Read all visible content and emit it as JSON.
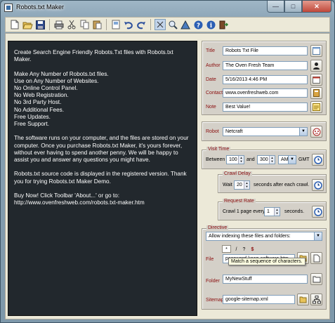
{
  "window": {
    "title": "Robots.txt Maker"
  },
  "toolbar": {
    "icons": [
      "new-file-icon",
      "open-folder-icon",
      "save-icon",
      "print-icon",
      "cut-icon",
      "copy-icon",
      "paste-icon",
      "preview-icon",
      "undo-icon",
      "redo-icon",
      "tile-icon",
      "search-icon",
      "shape-icon",
      "help-icon",
      "info-icon"
    ]
  },
  "content": {
    "paragraphs": [
      "Create Search Engine Friendly Robots.Txt files with Robots.txt Maker.",
      "Make Any Number of Robots.txt files.\nUse on Any Number of Websites.\nNo Online Control Panel.\nNo Web Registration.\nNo 3rd Party Host.\nNo Additional Fees.\nFree Updates.\nFree Support.",
      "The software runs on your computer, and the files are stored on your computer.  Once you purchase Robots.txt Maker, it's yours forever, without ever having to spend another penny.  We will be happy to assist you and answer any questions you might have.",
      "Robots.txt source code is displayed in the registered version. Thank you for trying Robots.txt Maker Demo.",
      "Buy Now!  Click Toolbar 'About...' or go to:\nhttp://www.ovenfreshweb.com/robots.txt-maker.htm"
    ]
  },
  "meta": {
    "title_label": "Title",
    "title_value": "Robots Txt File",
    "author_label": "Author",
    "author_value": "The Oven Fresh Team",
    "date_label": "Date",
    "date_value": "5/16/2013 4:46 PM",
    "contact_label": "Contact",
    "contact_value": "www.ovenfreshweb.com",
    "note_label": "Note",
    "note_value": "Best Value!"
  },
  "robot": {
    "label": "Robot",
    "value": "Netcraft"
  },
  "visit_time": {
    "legend": "Visit Time",
    "between_label": "Between",
    "start": "100",
    "and_label": "and",
    "end": "300",
    "ampm": "AM",
    "tz": "GMT"
  },
  "crawl_delay": {
    "legend": "Crawl Delay",
    "wait_label": "Wait",
    "value": "20",
    "suffix": "seconds after each crawl."
  },
  "request_rate": {
    "legend": "Request Rate",
    "prefix": "Crawl 1 page every",
    "value": "1",
    "suffix": "seconds."
  },
  "directive": {
    "legend": "Directive",
    "select_value": "Allow indexing these files and folders:",
    "tokens": [
      "*",
      "/",
      "?",
      "$"
    ],
    "file_label": "File",
    "file_value": "password-keep-software.htm",
    "tooltip": "Match a sequence of characters.",
    "folder_label": "Folder",
    "folder_value": "MyNewStuff",
    "sitemap_label": "Sitemap",
    "sitemap_value": "google-sitemap.xml"
  }
}
